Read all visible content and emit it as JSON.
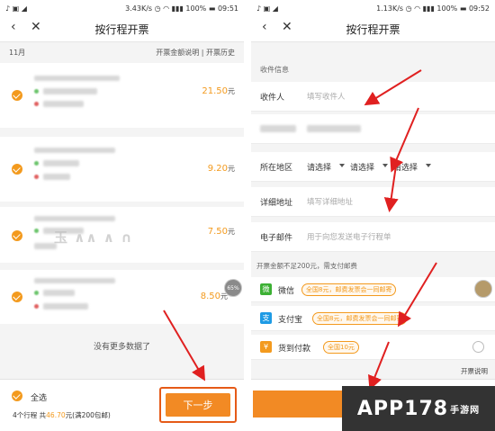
{
  "left": {
    "status": {
      "speed": "3.43K/s",
      "battery": "100%",
      "time": "09:51"
    },
    "nav": {
      "back": "‹",
      "close": "✕",
      "title": "按行程开票"
    },
    "subheader": {
      "month": "11月",
      "links": "开票金额说明 | 开票历史"
    },
    "trips": [
      {
        "amount": "21.50",
        "unit": "元"
      },
      {
        "amount": "9.20",
        "unit": "元"
      },
      {
        "amount": "7.50",
        "unit": "元"
      },
      {
        "amount": "8.50",
        "unit": "元",
        "badge": "65%"
      }
    ],
    "no_more": "没有更多数据了",
    "footer": {
      "select_all": "全选",
      "summary_pre": "4个行程 共",
      "summary_total": "46.70",
      "summary_post": "元(满200包邮)",
      "next": "下一步"
    }
  },
  "right": {
    "status": {
      "speed": "1.13K/s",
      "battery": "100%",
      "time": "09:52"
    },
    "nav": {
      "back": "‹",
      "close": "✕",
      "title": "按行程开票"
    },
    "section": "收件信息",
    "recipient": {
      "label": "收件人",
      "placeholder": "填写收件人"
    },
    "region": {
      "label": "所在地区",
      "select1": "请选择",
      "select2": "请选择",
      "select3": "请选择"
    },
    "address": {
      "label": "详细地址",
      "placeholder": "填写详细地址"
    },
    "email": {
      "label": "电子邮件",
      "placeholder": "用于向您发送电子行程单"
    },
    "pay_note": "开票金额不足200元，需支付邮费",
    "payments": [
      {
        "icon": "微",
        "name": "微信",
        "tag": "全国8元，邮费发票会一同邮寄",
        "color": "#3cb034"
      },
      {
        "icon": "支",
        "name": "支付宝",
        "tag": "全国8元，邮费发票会一同邮寄",
        "color": "#1e9be5"
      },
      {
        "icon": "¥",
        "name": "货到付款",
        "tag": "全国10元",
        "color": "#f39a1e"
      }
    ],
    "invoice_note": "开票说明"
  },
  "watermark": {
    "main": "APP178",
    "sub": "手游网"
  },
  "colors": {
    "accent": "#f39a1e",
    "arrow": "#e02020"
  }
}
